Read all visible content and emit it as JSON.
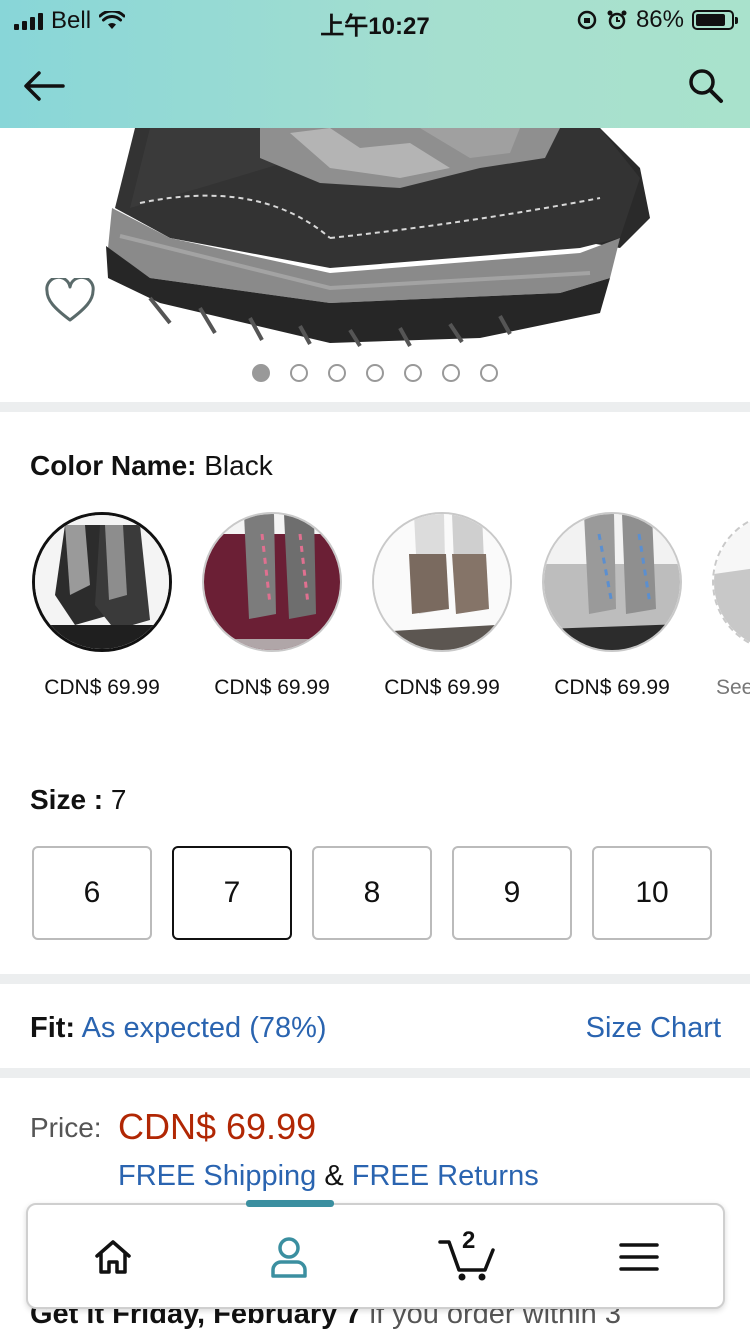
{
  "status_bar": {
    "carrier": "Bell",
    "time": "上午10:27",
    "battery": "86%",
    "battery_level": 0.86
  },
  "header": {
    "back_icon": "arrow-left-icon",
    "search_icon": "search-icon"
  },
  "gallery": {
    "image_count": 7,
    "active_index": 0,
    "wishlist_icon": "heart-outline-icon"
  },
  "color": {
    "label": "Color Name:",
    "value": "Black",
    "options": [
      {
        "price": "CDN$ 69.99",
        "color": "#2b2b2b",
        "selected": true
      },
      {
        "price": "CDN$ 69.99",
        "color": "#6b1f35",
        "selected": false
      },
      {
        "price": "CDN$ 69.99",
        "color": "#e8e6e2",
        "selected": false
      },
      {
        "price": "CDN$ 69.99",
        "color": "#a9a9a9",
        "selected": false
      },
      {
        "price": "See",
        "color": "#f0f0f0",
        "selected": false
      }
    ]
  },
  "size": {
    "label": "Size :",
    "value": "7",
    "options": [
      "6",
      "7",
      "8",
      "9",
      "10"
    ],
    "selected": "7"
  },
  "fit": {
    "label": "Fit:",
    "value": "As expected (78%)",
    "size_chart": "Size Chart"
  },
  "price": {
    "label": "Price:",
    "value": "CDN$ 69.99",
    "free_shipping": "FREE Shipping",
    "amp": "&",
    "free_returns": "FREE Returns"
  },
  "delivery": {
    "bold": "Get it Friday, February 7",
    "rest": " if you order within 3"
  },
  "bottom_nav": {
    "items": [
      "home-icon",
      "account-icon",
      "cart-icon",
      "menu-icon"
    ],
    "cart_count": "2",
    "active": "account"
  },
  "colors": {
    "link": "#2a64b0",
    "price": "#b12704",
    "header_gradient_start": "#88d6d8",
    "header_gradient_end": "#a9e2cc"
  }
}
